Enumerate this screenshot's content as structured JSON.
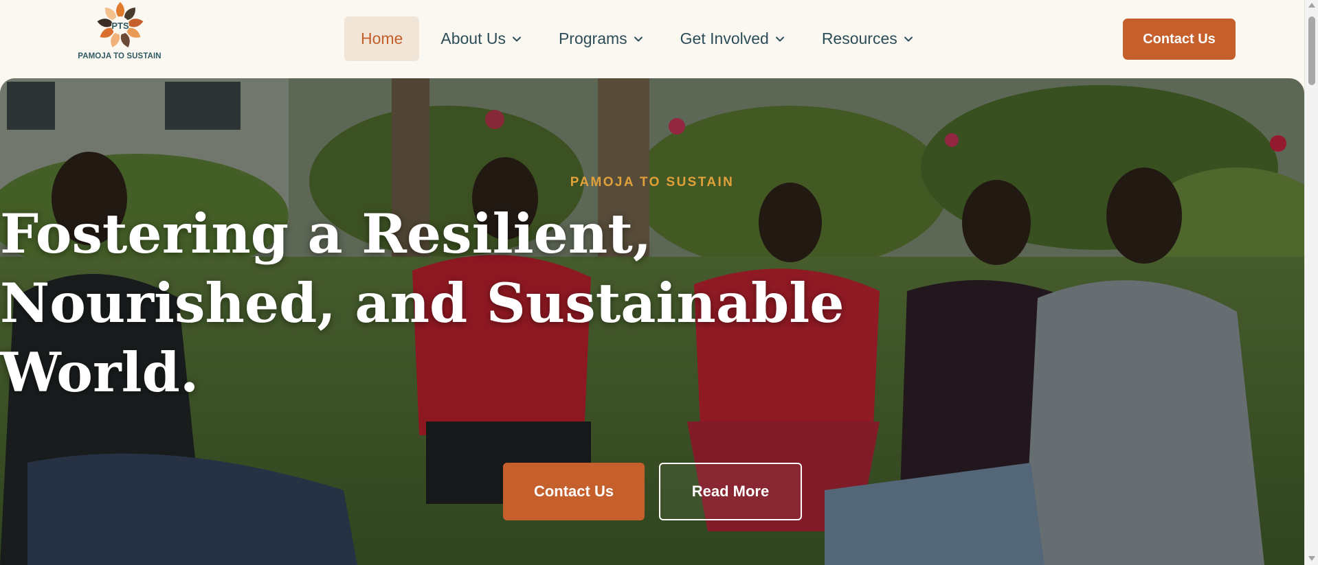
{
  "brand": {
    "logo_initials": "PTS",
    "logo_text": "PAMOJA TO SUSTAIN",
    "logo_icon": "leaf-ring-icon",
    "colors": {
      "primary": "#c55f2c",
      "text_dark": "#2c4d57",
      "eyebrow": "#e0a03a",
      "background": "#fbf8f2"
    }
  },
  "nav": {
    "items": [
      {
        "label": "Home",
        "active": true
      },
      {
        "label": "About Us",
        "dropdown": true
      },
      {
        "label": "Programs",
        "dropdown": true
      },
      {
        "label": "Get Involved",
        "dropdown": true
      },
      {
        "label": "Resources",
        "dropdown": true
      }
    ],
    "cta_label": "Contact Us"
  },
  "hero": {
    "eyebrow": "PAMOJA TO SUSTAIN",
    "headline_lines": [
      "Fostering a Resilient,",
      "Nourished, and Sustainable",
      "World."
    ],
    "primary_button": "Contact Us",
    "secondary_button": "Read More",
    "background_image": "group-discussion-garden-photo"
  }
}
